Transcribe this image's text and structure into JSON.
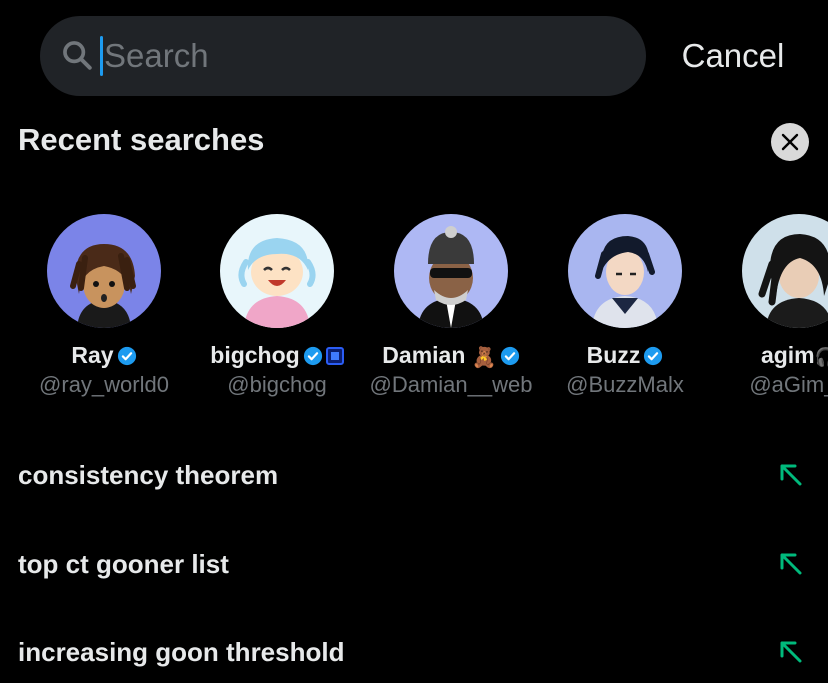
{
  "search": {
    "placeholder": "Search",
    "value": "",
    "cancel_label": "Cancel"
  },
  "recent": {
    "title": "Recent searches",
    "users": [
      {
        "name": "Ray",
        "handle": "@ray_world0",
        "verified": true
      },
      {
        "name": "bigchog",
        "handle": "@bigchog",
        "verified": true,
        "extra_badge": "blue-square"
      },
      {
        "name": "Damian",
        "handle": "@Damian__web",
        "verified": true,
        "emoji": "🧸"
      },
      {
        "name": "Buzz",
        "handle": "@BuzzMalx",
        "verified": true
      },
      {
        "name": "agim",
        "handle": "@aGim_a",
        "verified": false
      }
    ],
    "queries": [
      "consistency theorem",
      "top ct gooner list",
      "increasing goon threshold"
    ]
  },
  "colors": {
    "background": "#000000",
    "search_bg": "#202327",
    "text": "#e7e9ea",
    "muted": "#71767b",
    "verified": "#1d9bf0",
    "arrow": "#00ba7c"
  }
}
